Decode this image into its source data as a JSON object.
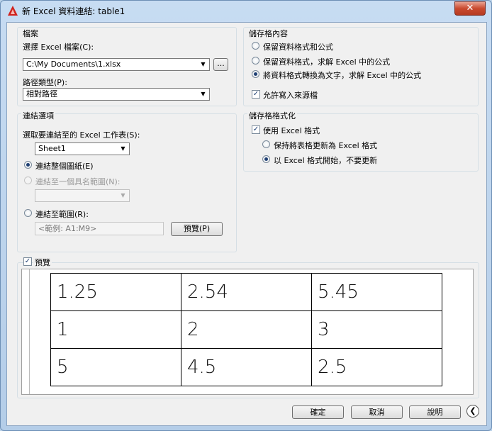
{
  "window": {
    "title": "新 Excel 資料連結: table1",
    "close": "✕"
  },
  "file_group": {
    "title": "檔案",
    "select_label": "選擇 Excel 檔案(C):",
    "file_path": "C:\\My Documents\\1.xlsx",
    "browse": "...",
    "path_type_label": "路徑類型(P):",
    "path_type": "相對路徑"
  },
  "link_group": {
    "title": "連結選項",
    "sheet_label": "選取要連結至的 Excel 工作表(S):",
    "sheet": "Sheet1",
    "opt_whole_sheet": "連結整個圖紙(E)",
    "opt_named_range": "連結至一個具名範圍(N):",
    "named_range": "",
    "opt_range": "連結至範圍(R):",
    "range_placeholder": "<範例: A1:M9>",
    "preview_btn": "預覽(P)"
  },
  "cell_content_group": {
    "title": "儲存格內容",
    "opt1": "保留資料格式和公式",
    "opt2": "保留資料格式，求解 Excel 中的公式",
    "opt3": "將資料格式轉換為文字，求解 Excel 中的公式",
    "allow_write": "允許寫入來源檔"
  },
  "cell_format_group": {
    "title": "儲存格格式化",
    "use_excel_format": "使用 Excel 格式",
    "opt_keep_updated": "保持將表格更新為 Excel 格式",
    "opt_start_no_update": "以 Excel 格式開始，不要更新"
  },
  "preview": {
    "checkbox_label": "預覽",
    "rows": [
      [
        "1.25",
        "2.54",
        "5.45"
      ],
      [
        "1",
        "2",
        "3"
      ],
      [
        "5",
        "4.5",
        "2.5"
      ]
    ]
  },
  "footer": {
    "ok": "確定",
    "cancel": "取消",
    "help": "說明",
    "back": "❮"
  },
  "colors": {
    "title_bar": "#c7dcf2",
    "close_button": "#c94a2f",
    "app_icon": "#d0211c",
    "radio_selected": "#1f3f73"
  }
}
